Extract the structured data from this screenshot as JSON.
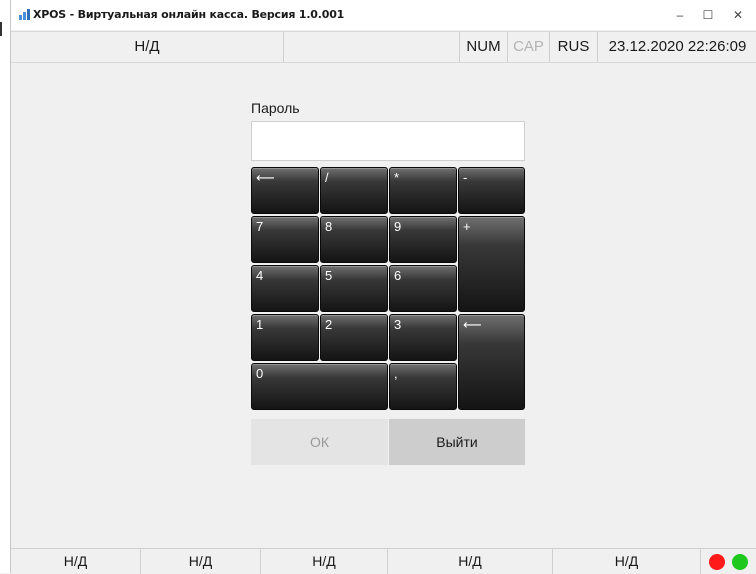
{
  "window": {
    "title": "XPOS - Виртуальная онлайн касса. Версия 1.0.001",
    "minimize_glyph": "–",
    "maximize_glyph": "☐",
    "close_glyph": "✕"
  },
  "top_status": {
    "field1": "Н/Д",
    "field2": "",
    "num": "NUM",
    "cap": "CAP",
    "lang": "RUS",
    "datetime": "23.12.2020 22:26:09"
  },
  "login": {
    "password_label": "Пароль",
    "password_value": ""
  },
  "keypad": {
    "backspace": "⟵",
    "divide": "/",
    "multiply": "*",
    "minus": "-",
    "k7": "7",
    "k8": "8",
    "k9": "9",
    "plus": "+",
    "k4": "4",
    "k5": "5",
    "k6": "6",
    "k1": "1",
    "k2": "2",
    "k3": "3",
    "enter": "⟵",
    "k0": "0",
    "comma": ","
  },
  "actions": {
    "ok_label": "ОК",
    "exit_label": "Выйти"
  },
  "bottom_status": {
    "fields": [
      "Н/Д",
      "Н/Д",
      "Н/Д",
      "Н/Д",
      "Н/Д"
    ],
    "indicators": [
      {
        "name": "red",
        "color": "#ff1a1a"
      },
      {
        "name": "green",
        "color": "#1ec81e"
      }
    ]
  }
}
